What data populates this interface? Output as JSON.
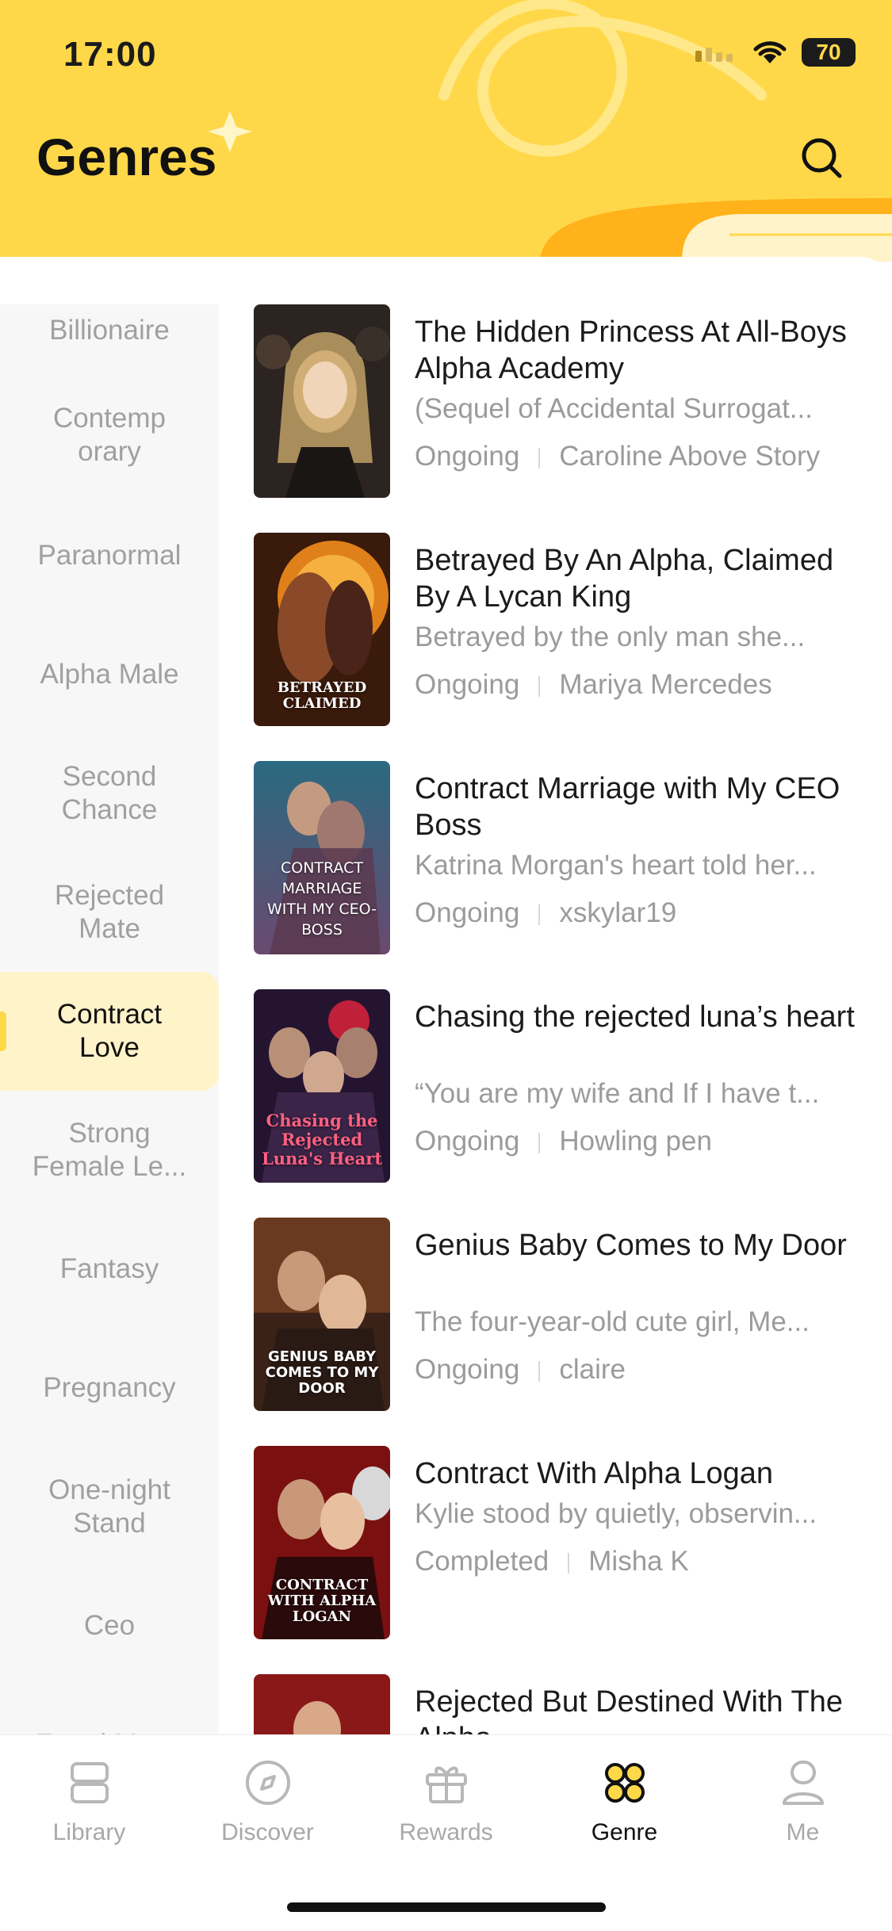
{
  "status_bar": {
    "time": "17:00",
    "battery": "70"
  },
  "header": {
    "title": "Genres"
  },
  "sidebar": {
    "items": [
      {
        "label": "Billionaire"
      },
      {
        "label": "Contemporary"
      },
      {
        "label": "Paranormal"
      },
      {
        "label": "Alpha Male"
      },
      {
        "label": "Second Chance"
      },
      {
        "label": "Rejected Mate"
      },
      {
        "label": "Contract Love",
        "active": true
      },
      {
        "label": "Strong Female Le..."
      },
      {
        "label": "Fantasy"
      },
      {
        "label": "Pregnancy"
      },
      {
        "label": "One-night Stand"
      },
      {
        "label": "Ceo"
      },
      {
        "label": "Fated Mat..."
      }
    ]
  },
  "books": [
    {
      "title": "The Hidden Princess At All-Boys Alpha Academy",
      "description": "(Sequel of Accidental Surrogat...",
      "status": "Ongoing",
      "author": "Caroline Above Story"
    },
    {
      "title": "Betrayed By An Alpha, Claimed By A Lycan King",
      "description": "Betrayed by the only man she...",
      "status": "Ongoing",
      "author": "Mariya Mercedes",
      "cover_text": "BETRAYED CLAIMED"
    },
    {
      "title": "Contract Marriage with My CEO Boss",
      "description": "Katrina Morgan's heart told her...",
      "status": "Ongoing",
      "author": "xskylar19",
      "cover_text": "CONTRACT MARRIAGE WITH MY CEO-BOSS"
    },
    {
      "title": "Chasing the rejected luna’s heart",
      "description": "“You are my wife and If I have t...",
      "status": "Ongoing",
      "author": "Howling pen",
      "cover_text": "Chasing the Rejected Luna's Heart"
    },
    {
      "title": "Genius Baby Comes to My Door",
      "description": "The four-year-old cute girl, Me...",
      "status": "Ongoing",
      "author": "claire",
      "cover_text": "GENIUS BABY COMES TO MY DOOR"
    },
    {
      "title": "Contract With Alpha Logan",
      "description": "Kylie stood by quietly, observin...",
      "status": "Completed",
      "author": "Misha K",
      "cover_text": "CONTRACT WITH ALPHA LOGAN"
    },
    {
      "title": "Rejected But Destined With The Alpha",
      "description": "",
      "status": "",
      "author": ""
    }
  ],
  "tabbar": {
    "tabs": [
      {
        "label": "Library",
        "icon": "library-icon"
      },
      {
        "label": "Discover",
        "icon": "compass-icon"
      },
      {
        "label": "Rewards",
        "icon": "gift-icon"
      },
      {
        "label": "Genre",
        "icon": "genre-icon",
        "active": true
      },
      {
        "label": "Me",
        "icon": "profile-icon"
      }
    ]
  },
  "colors": {
    "accent": "#ffd84a",
    "active_genre_bg": "#fff3c9",
    "muted_text": "#9b9b9b"
  }
}
